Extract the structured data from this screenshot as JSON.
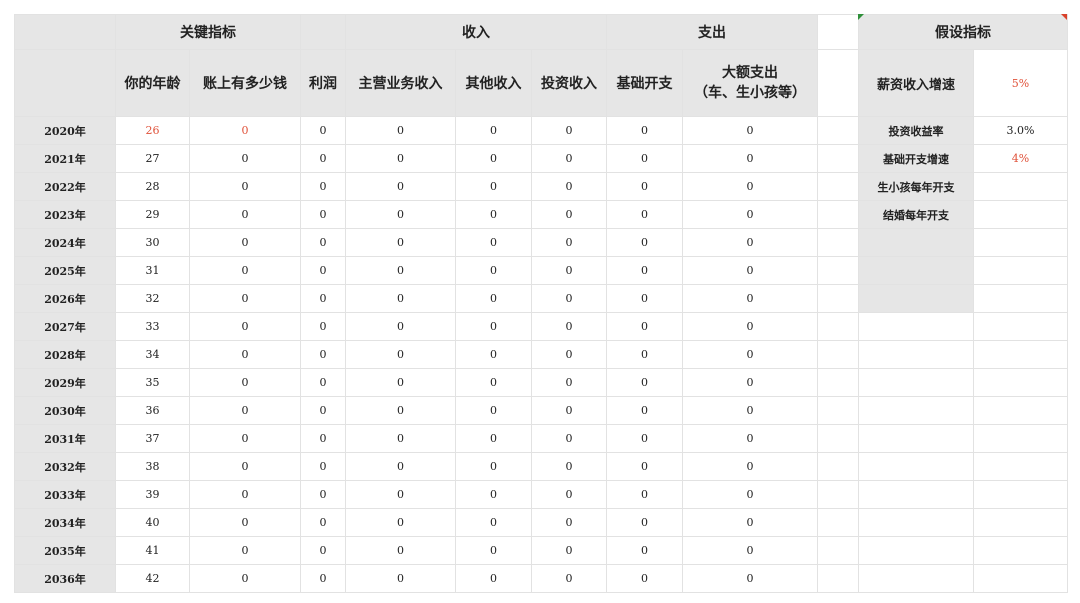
{
  "headers": {
    "key_metrics": "关键指标",
    "income": "收入",
    "expense": "支出",
    "assumptions": "假设指标"
  },
  "columns": {
    "age": "你的年龄",
    "balance": "账上有多少钱",
    "profit": "利润",
    "main_income": "主营业务收入",
    "other_income": "其他收入",
    "investment_income": "投资收入",
    "basic_expense": "基础开支",
    "large_expense_line1": "大额支出",
    "large_expense_line2": "（车、生小孩等）"
  },
  "rows": [
    {
      "year": "2020年",
      "age": "26",
      "balance": "0",
      "profit": "0",
      "main_income": "0",
      "other_income": "0",
      "investment_income": "0",
      "basic_expense": "0",
      "large_expense": "0"
    },
    {
      "year": "2021年",
      "age": "27",
      "balance": "0",
      "profit": "0",
      "main_income": "0",
      "other_income": "0",
      "investment_income": "0",
      "basic_expense": "0",
      "large_expense": "0"
    },
    {
      "year": "2022年",
      "age": "28",
      "balance": "0",
      "profit": "0",
      "main_income": "0",
      "other_income": "0",
      "investment_income": "0",
      "basic_expense": "0",
      "large_expense": "0"
    },
    {
      "year": "2023年",
      "age": "29",
      "balance": "0",
      "profit": "0",
      "main_income": "0",
      "other_income": "0",
      "investment_income": "0",
      "basic_expense": "0",
      "large_expense": "0"
    },
    {
      "year": "2024年",
      "age": "30",
      "balance": "0",
      "profit": "0",
      "main_income": "0",
      "other_income": "0",
      "investment_income": "0",
      "basic_expense": "0",
      "large_expense": "0"
    },
    {
      "year": "2025年",
      "age": "31",
      "balance": "0",
      "profit": "0",
      "main_income": "0",
      "other_income": "0",
      "investment_income": "0",
      "basic_expense": "0",
      "large_expense": "0"
    },
    {
      "year": "2026年",
      "age": "32",
      "balance": "0",
      "profit": "0",
      "main_income": "0",
      "other_income": "0",
      "investment_income": "0",
      "basic_expense": "0",
      "large_expense": "0"
    },
    {
      "year": "2027年",
      "age": "33",
      "balance": "0",
      "profit": "0",
      "main_income": "0",
      "other_income": "0",
      "investment_income": "0",
      "basic_expense": "0",
      "large_expense": "0"
    },
    {
      "year": "2028年",
      "age": "34",
      "balance": "0",
      "profit": "0",
      "main_income": "0",
      "other_income": "0",
      "investment_income": "0",
      "basic_expense": "0",
      "large_expense": "0"
    },
    {
      "year": "2029年",
      "age": "35",
      "balance": "0",
      "profit": "0",
      "main_income": "0",
      "other_income": "0",
      "investment_income": "0",
      "basic_expense": "0",
      "large_expense": "0"
    },
    {
      "year": "2030年",
      "age": "36",
      "balance": "0",
      "profit": "0",
      "main_income": "0",
      "other_income": "0",
      "investment_income": "0",
      "basic_expense": "0",
      "large_expense": "0"
    },
    {
      "year": "2031年",
      "age": "37",
      "balance": "0",
      "profit": "0",
      "main_income": "0",
      "other_income": "0",
      "investment_income": "0",
      "basic_expense": "0",
      "large_expense": "0"
    },
    {
      "year": "2032年",
      "age": "38",
      "balance": "0",
      "profit": "0",
      "main_income": "0",
      "other_income": "0",
      "investment_income": "0",
      "basic_expense": "0",
      "large_expense": "0"
    },
    {
      "year": "2033年",
      "age": "39",
      "balance": "0",
      "profit": "0",
      "main_income": "0",
      "other_income": "0",
      "investment_income": "0",
      "basic_expense": "0",
      "large_expense": "0"
    },
    {
      "year": "2034年",
      "age": "40",
      "balance": "0",
      "profit": "0",
      "main_income": "0",
      "other_income": "0",
      "investment_income": "0",
      "basic_expense": "0",
      "large_expense": "0"
    },
    {
      "year": "2035年",
      "age": "41",
      "balance": "0",
      "profit": "0",
      "main_income": "0",
      "other_income": "0",
      "investment_income": "0",
      "basic_expense": "0",
      "large_expense": "0"
    },
    {
      "year": "2036年",
      "age": "42",
      "balance": "0",
      "profit": "0",
      "main_income": "0",
      "other_income": "0",
      "investment_income": "0",
      "basic_expense": "0",
      "large_expense": "0"
    }
  ],
  "assumptions": [
    {
      "label": "薪资收入增速",
      "value": "5%"
    },
    {
      "label": "投资收益率",
      "value": "3.0%"
    },
    {
      "label": "基础开支增速",
      "value": "4%"
    },
    {
      "label": "生小孩每年开支",
      "value": ""
    },
    {
      "label": "结婚每年开支",
      "value": ""
    }
  ],
  "colors": {
    "input_highlight": "#e0523a",
    "header_bg": "#e6e6e6",
    "comment_marker_green": "#2f8f3a",
    "comment_marker_red": "#d9412b"
  }
}
